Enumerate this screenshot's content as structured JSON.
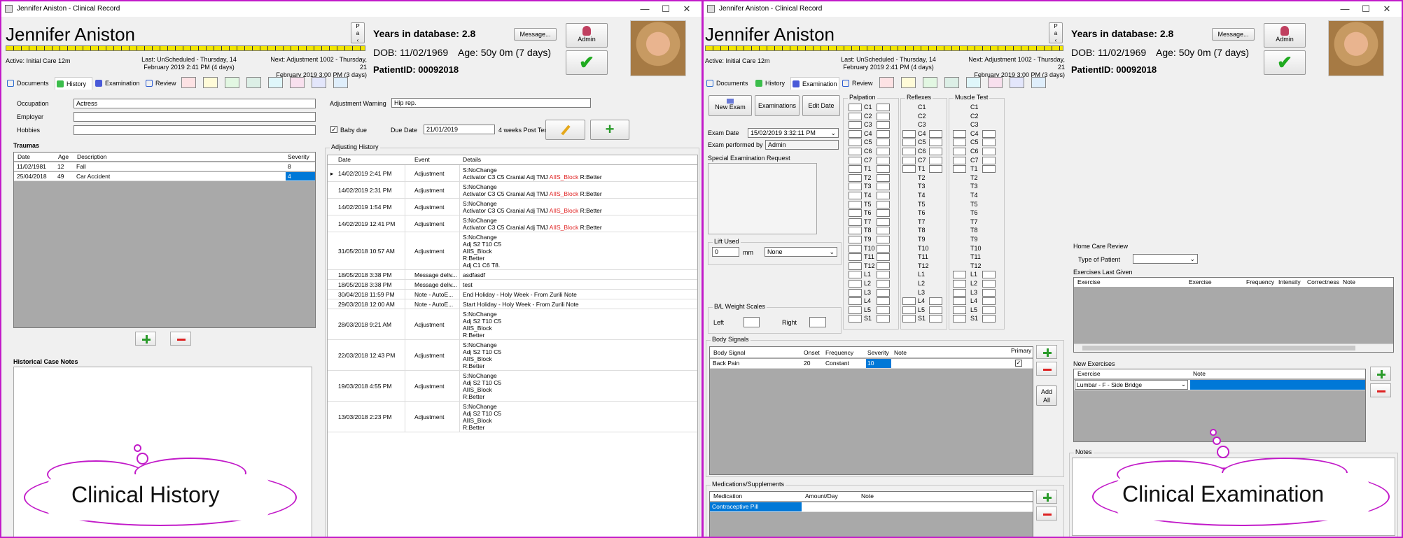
{
  "left": {
    "title": "Jennifer Aniston - Clinical Record",
    "patient_name": "Jennifer Aniston",
    "years": "Years in database: 2.8",
    "dob": "DOB: 11/02/1969",
    "age": "Age: 50y 0m (7 days)",
    "pid": "PatientID: 00092018",
    "message_btn": "Message...",
    "admin_btn": "Admin",
    "active": "Active: Initial Care 12m",
    "last1": "Last: UnScheduled - Thursday, 14",
    "last2": "February 2019 2:41 PM (4 days)",
    "next1": "Next: Adjustment 1002 - Thursday, 21",
    "next2": "February 2019 3:00 PM (3 days)",
    "tabs": [
      "Documents",
      "History",
      "Examination",
      "Review"
    ],
    "occupation_label": "Occupation",
    "occupation": "Actress",
    "employer_label": "Employer",
    "employer": "",
    "hobbies_label": "Hobbies",
    "hobbies": "",
    "adj_warning_label": "Adjustment Warning",
    "adj_warning": "Hip rep.",
    "baby_due_label": "Baby due",
    "due_date_label": "Due Date",
    "due_date": "21/01/2019",
    "weeks": "4 weeks Post Ter",
    "traumas_title": "Traumas",
    "trauma_headers": [
      "Date",
      "Age",
      "Description",
      "Severity"
    ],
    "traumas": [
      [
        "11/02/1981",
        "12",
        "Fall",
        "8"
      ],
      [
        "25/04/2018",
        "49",
        "Car Accident",
        "4"
      ]
    ],
    "case_notes_title": "Historical Case Notes",
    "adjusting_title": "Adjusting History",
    "adj_headers": [
      "Date",
      "Event",
      "Details"
    ],
    "adjustments": [
      {
        "date": "14/02/2019 2:41 PM",
        "event": "Adjustment",
        "lines": [
          "S:NoChange"
        ],
        "red_line": [
          "Activator C3 C5 Cranial Adj TMJ ",
          "AIIS_Block",
          " R:Better"
        ]
      },
      {
        "date": "14/02/2019 2:31 PM",
        "event": "Adjustment",
        "lines": [
          "S:NoChange"
        ],
        "red_line": [
          "Activator C3 C5 Cranial Adj TMJ ",
          "AIIS_Block",
          " R:Better"
        ]
      },
      {
        "date": "14/02/2019 1:54 PM",
        "event": "Adjustment",
        "lines": [
          "S:NoChange"
        ],
        "red_line": [
          "Activator C3 C5 Cranial Adj TMJ ",
          "AIIS_Block",
          " R:Better"
        ]
      },
      {
        "date": "14/02/2019 12:41 PM",
        "event": "Adjustment",
        "lines": [
          "S:NoChange"
        ],
        "red_line": [
          "Activator C3 C5 Cranial Adj TMJ ",
          "AIIS_Block",
          " R:Better"
        ]
      },
      {
        "date": "31/05/2018 10:57 AM",
        "event": "Adjustment",
        "lines": [
          "S:NoChange",
          "Adj S2 T10 C5",
          "AIIS_Block",
          "R:Better",
          "Adj C1 C6 T8."
        ]
      },
      {
        "date": "18/05/2018 3:38 PM",
        "event": "Message deliv...",
        "lines": [
          "asdfasdf"
        ]
      },
      {
        "date": "18/05/2018 3:38 PM",
        "event": "Message deliv...",
        "lines": [
          "test"
        ]
      },
      {
        "date": "30/04/2018 11:59 PM",
        "event": "Note - AutoE...",
        "lines": [
          "End Holiday - Holy Week - From Zurili Note"
        ]
      },
      {
        "date": "29/03/2018 12:00 AM",
        "event": "Note - AutoE...",
        "lines": [
          "Start Holiday - Holy Week - From Zurili Note"
        ]
      },
      {
        "date": "28/03/2018 9:21 AM",
        "event": "Adjustment",
        "lines": [
          "S:NoChange",
          "Adj S2 T10 C5",
          "AIIS_Block",
          "R:Better"
        ]
      },
      {
        "date": "22/03/2018 12:43 PM",
        "event": "Adjustment",
        "lines": [
          "S:NoChange",
          "Adj S2 T10 C5",
          "AIIS_Block",
          "R:Better"
        ]
      },
      {
        "date": "19/03/2018 4:55 PM",
        "event": "Adjustment",
        "lines": [
          "S:NoChange",
          "Adj S2 T10 C5",
          "AIIS_Block",
          "R:Better"
        ]
      },
      {
        "date": "13/03/2018 2:23 PM",
        "event": "Adjustment",
        "lines": [
          "S:NoChange",
          "Adj S2 T10 C5",
          "AIIS_Block",
          "R:Better"
        ]
      }
    ],
    "callout": "Clinical History"
  },
  "right": {
    "title": "Jennifer Aniston - Clinical Record",
    "patient_name": "Jennifer Aniston",
    "years": "Years in database: 2.8",
    "dob": "DOB: 11/02/1969",
    "age": "Age: 50y 0m (7 days)",
    "pid": "PatientID: 00092018",
    "message_btn": "Message...",
    "admin_btn": "Admin",
    "active": "Active: Initial Care 12m",
    "last1": "Last: UnScheduled - Thursday, 14",
    "last2": "February 2019 2:41 PM (4 days)",
    "next1": "Next: Adjustment 1002 - Thursday, 21",
    "next2": "February 2019 3:00 PM (3 days)",
    "tabs": [
      "Documents",
      "History",
      "Examination",
      "Review"
    ],
    "new_exam": "New Exam",
    "examinations": "Examinations",
    "edit_date": "Edit Date",
    "exam_date_label": "Exam Date",
    "exam_date": "15/02/2019 3:32:11 PM",
    "performed_label": "Exam performed by",
    "performed": "Admin",
    "special_label": "Special Examination Request",
    "lift_title": "Lift Used",
    "lift_value": "0",
    "lift_unit": "mm",
    "lift_select": "None",
    "bl_title": "B/L Weight Scales",
    "bl_left": "Left",
    "bl_right": "Right",
    "palpation": "Palpation",
    "reflexes": "Reflexes",
    "muscle": "Muscle Test",
    "vertebrae": [
      "C1",
      "C2",
      "C3",
      "C4",
      "C5",
      "C6",
      "C7",
      "T1",
      "T2",
      "T3",
      "T4",
      "T5",
      "T6",
      "T7",
      "T8",
      "T9",
      "T10",
      "T11",
      "T12",
      "L1",
      "L2",
      "L3",
      "L4",
      "L5",
      "S1"
    ],
    "body_title": "Body Signals",
    "body_headers": [
      "Body Signal",
      "Onset",
      "Frequency",
      "Severity",
      "Note",
      "Primary"
    ],
    "body_row": [
      "Back Pain",
      "20",
      "Constant",
      "10",
      "",
      ""
    ],
    "add_all": "Add All",
    "med_title": "Medications/Supplements",
    "med_headers": [
      "Medication",
      "Amount/Day",
      "Note"
    ],
    "med_row": [
      "Contraceptive Pill",
      "",
      ""
    ],
    "home_title": "Home Care Review",
    "type_label": "Type of Patient",
    "last_given": "Exercises Last Given",
    "last_headers": [
      "Exercise",
      "Exercise",
      "Frequency",
      "Intensity",
      "Correctness",
      "Note"
    ],
    "new_ex_title": "New Exercises",
    "new_headers": [
      "Exercise",
      "Note"
    ],
    "new_row": "Lumbar - F - Side Bridge",
    "notes_title": "Notes",
    "callout": "Clinical Examination"
  },
  "colors": {
    "accent": "#c21bc9",
    "selection": "#0078d7",
    "green": "#2b9b2b"
  }
}
